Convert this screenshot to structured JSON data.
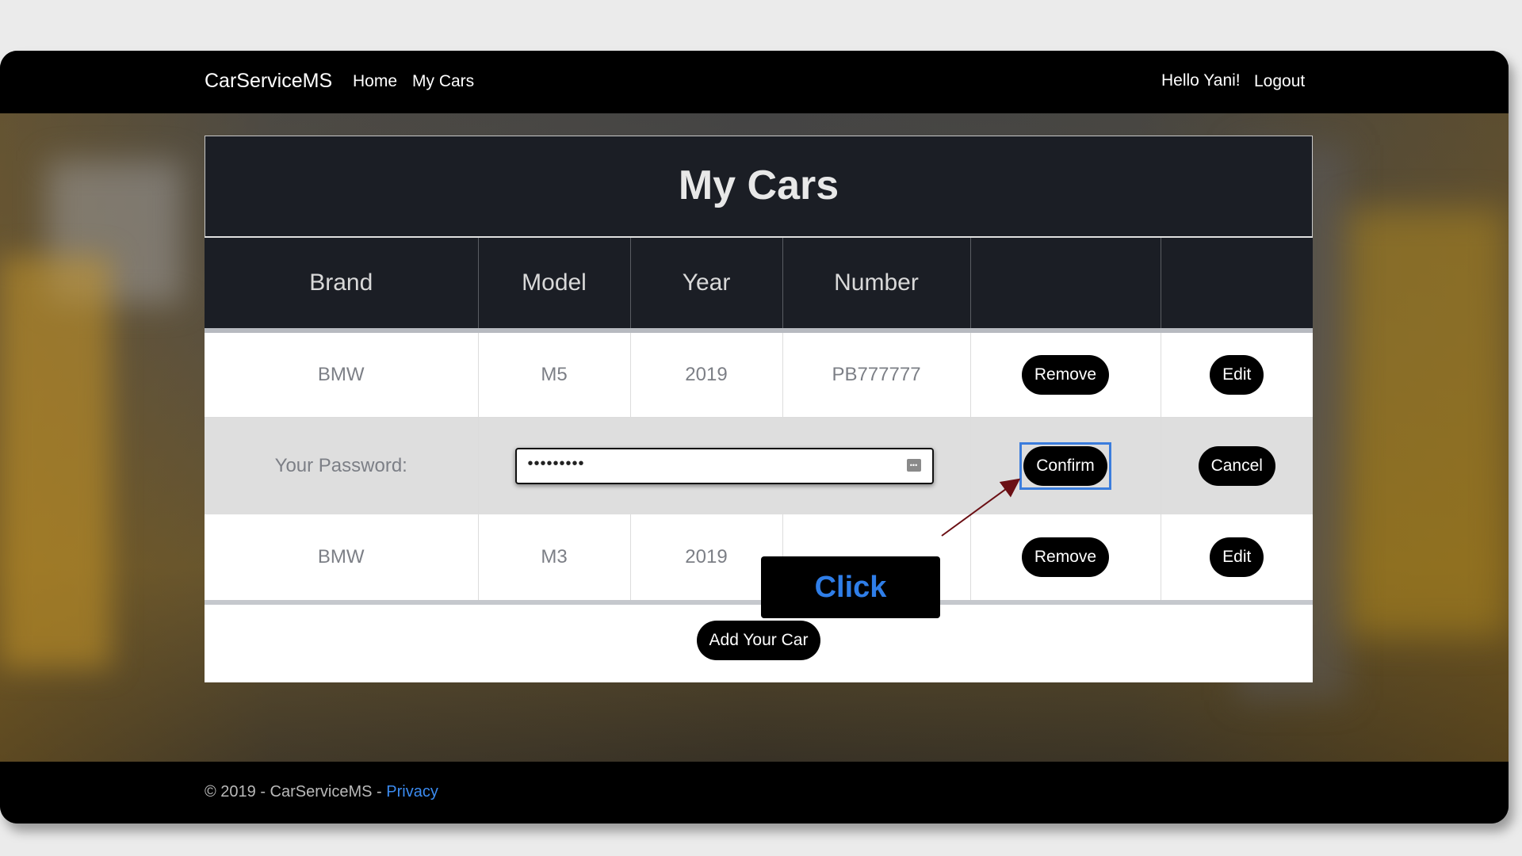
{
  "navbar": {
    "brand": "CarServiceMS",
    "links": [
      "Home",
      "My Cars"
    ],
    "greeting": "Hello Yani!",
    "logout": "Logout"
  },
  "card": {
    "title": "My Cars",
    "columns": [
      "Brand",
      "Model",
      "Year",
      "Number",
      "",
      ""
    ],
    "rows": [
      {
        "brand": "BMW",
        "model": "M5",
        "year": "2019",
        "number": "PB777777",
        "remove": "Remove",
        "edit": "Edit"
      },
      {
        "brand": "BMW",
        "model": "M3",
        "year": "2019",
        "number": "",
        "remove": "Remove",
        "edit": "Edit"
      }
    ],
    "password_row": {
      "label": "Your Password:",
      "value": "•••••••••",
      "confirm": "Confirm",
      "cancel": "Cancel"
    },
    "add_button": "Add Your Car"
  },
  "callout": {
    "text": "Click",
    "highlight_color": "#3b7ddd",
    "text_color": "#2f7ee8"
  },
  "footer": {
    "text": "© 2019 - CarServiceMS - ",
    "link": "Privacy"
  },
  "colors": {
    "header_bg": "#1b1e25",
    "accent_link": "#3b8bf0"
  }
}
